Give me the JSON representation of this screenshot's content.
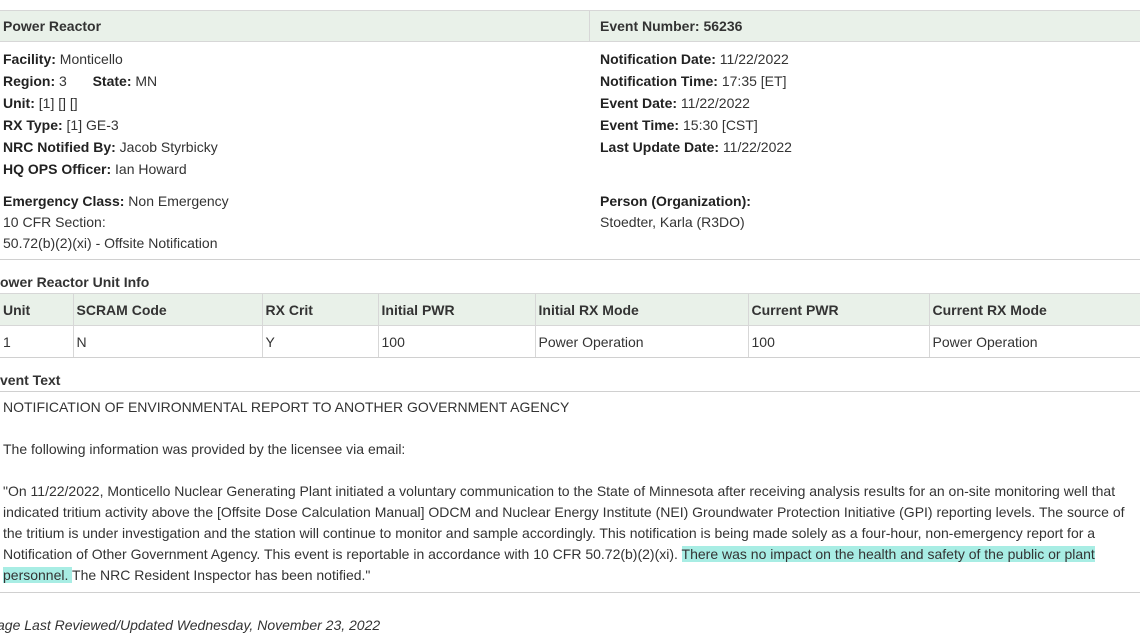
{
  "header": {
    "left_title": "Power Reactor",
    "right_label": "Event Number:",
    "right_value": "56236"
  },
  "facility_info": {
    "facility_label": "Facility:",
    "facility": "Monticello",
    "region_label": "Region:",
    "region": "3",
    "state_label": "State:",
    "state": "MN",
    "unit_label": "Unit:",
    "unit": "[1] [] []",
    "rx_type_label": "RX Type:",
    "rx_type": "[1] GE-3",
    "nrc_notified_label": "NRC Notified By:",
    "nrc_notified": "Jacob Styrbicky",
    "hq_ops_label": "HQ OPS Officer:",
    "hq_ops": "Ian Howard"
  },
  "event_info": {
    "notification_date_label": "Notification Date:",
    "notification_date": "11/22/2022",
    "notification_time_label": "Notification Time:",
    "notification_time": "17:35 [ET]",
    "event_date_label": "Event Date:",
    "event_date": "11/22/2022",
    "event_time_label": "Event Time:",
    "event_time": "15:30 [CST]",
    "last_update_label": "Last Update Date:",
    "last_update": "11/22/2022"
  },
  "classification": {
    "emergency_class_label": "Emergency Class:",
    "emergency_class": "Non Emergency",
    "cfr_label": "10 CFR Section:",
    "cfr_value": "50.72(b)(2)(xi) - Offsite Notification"
  },
  "person": {
    "label": "Person (Organization):",
    "value": "Stoedter, Karla (R3DO)"
  },
  "unit_info": {
    "title": "ower Reactor Unit Info",
    "columns": [
      "Unit",
      "SCRAM Code",
      "RX Crit",
      "Initial PWR",
      "Initial RX Mode",
      "Current PWR",
      "Current RX Mode"
    ],
    "rows": [
      [
        "1",
        "N",
        "Y",
        "100",
        "Power Operation",
        "100",
        "Power Operation"
      ]
    ]
  },
  "event_text": {
    "title": "vent Text",
    "p1": "NOTIFICATION OF ENVIRONMENTAL REPORT TO ANOTHER GOVERNMENT AGENCY",
    "p2": "The following information was provided by the licensee via email:",
    "p3_start": "\"On 11/22/2022, Monticello Nuclear Generating Plant initiated a voluntary communication to the State of Minnesota after receiving analysis results for an on-site monitoring well that indicated tritium activity above the [Offsite Dose Calculation Manual] ODCM and Nuclear Energy Institute (NEI) Groundwater Protection Initiative (GPI) reporting levels. The source of the tritium is under investigation and the station will continue to monitor and sample accordingly. This notification is being made solely as a four-hour, non-emergency report for a Notification of Other Government Agency. This event is reportable in accordance with 10 CFR 50.72(b)(2)(xi). ",
    "p3_highlight": "There was no impact on the health and safety of the public or plant personnel. ",
    "p3_end": "The NRC Resident Inspector has been notified.\""
  },
  "footer": {
    "text": "age Last Reviewed/Updated Wednesday, November 23, 2022"
  },
  "colors": {
    "header_bg": "#e9f1e9",
    "highlight": "#a8ede4",
    "border": "#d7d7d7"
  }
}
